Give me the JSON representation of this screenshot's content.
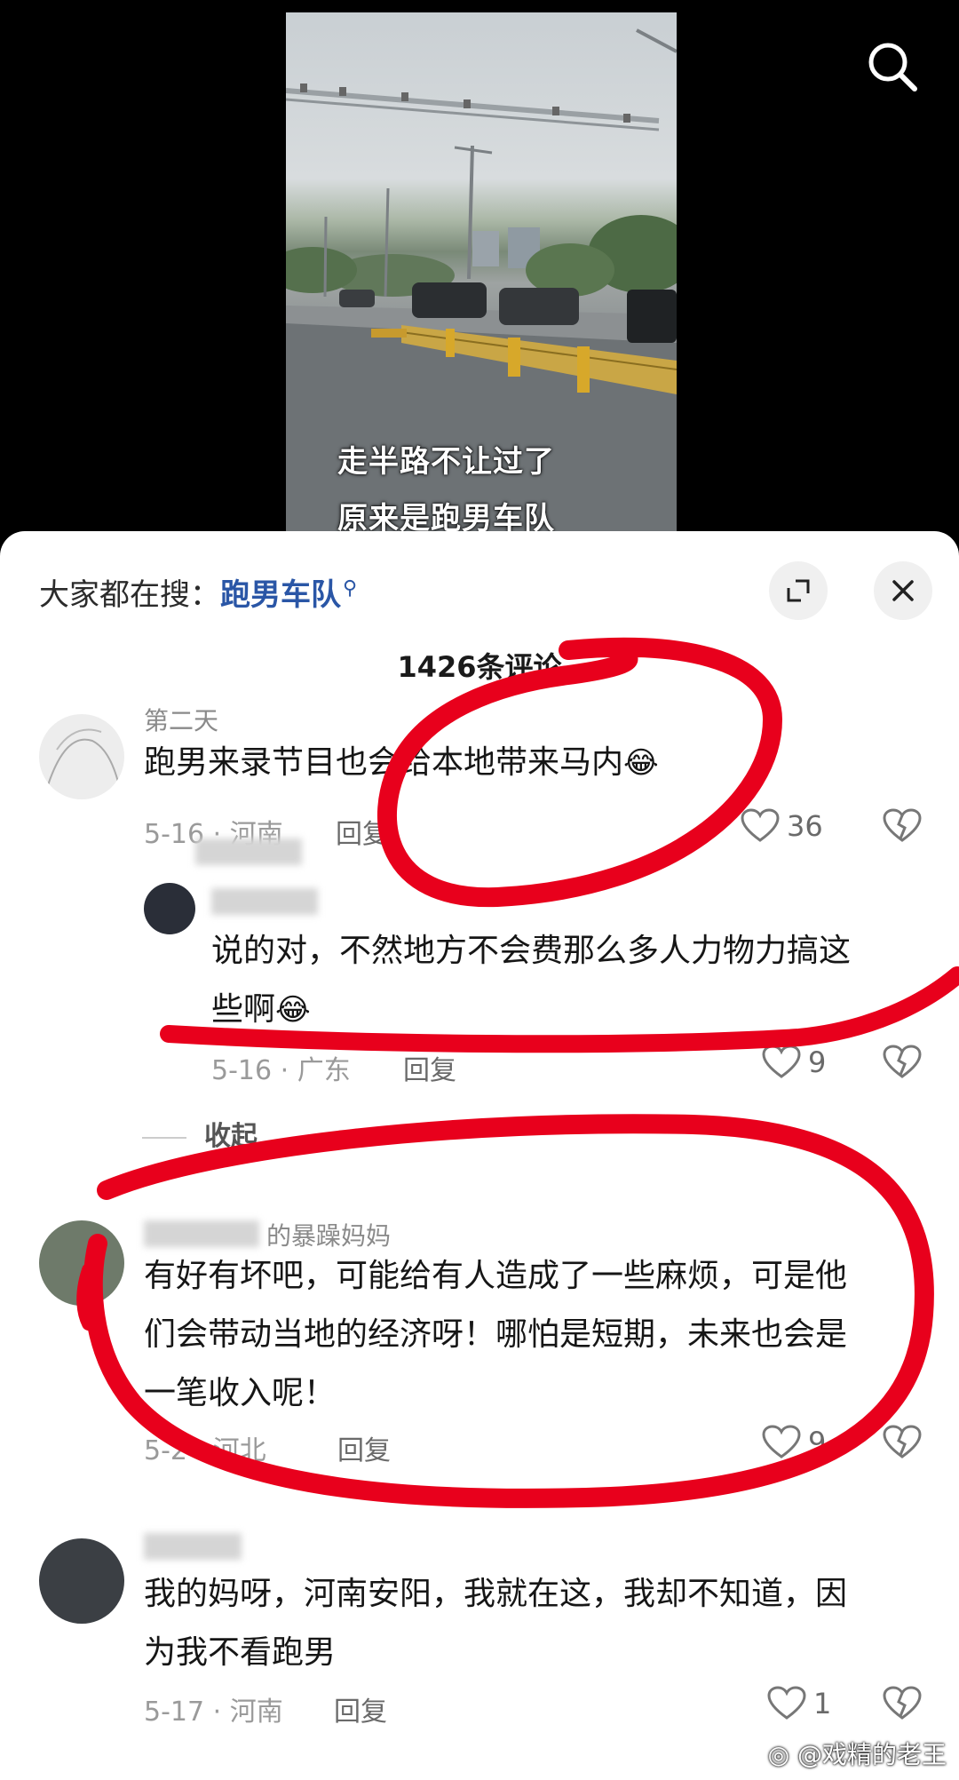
{
  "video": {
    "caption_line1": "走半路不让过了",
    "caption_line2": "原来是跑男车队",
    "search_icon": "search-icon"
  },
  "header": {
    "hot_search_prefix": "大家都在搜：",
    "hot_search_keyword": "跑男车队",
    "expand_icon": "expand-icon",
    "close_icon": "close-icon"
  },
  "comment_count": "1426条评论",
  "comments": [
    {
      "username": "第二天",
      "text": "跑男来录节目也会给本地带来马内",
      "emoji": "😂",
      "date_location": "5-16 · 河南",
      "reply_label": "回复",
      "likes": "36"
    },
    {
      "username": "",
      "text_line1": "说的对，不然地方不会费那么多人力物力搞这",
      "text_line2": "些啊",
      "emoji": "😂",
      "date_location": "5-16 · 广东",
      "reply_label": "回复",
      "likes": "9"
    },
    {
      "username": "的暴躁妈妈",
      "text_line1": "有好有坏吧，可能给有人造成了一些麻烦，可是他",
      "text_line2": "们会带动当地的经济呀！哪怕是短期，未来也会是",
      "text_line3": "一笔收入呢！",
      "date_location": "5-2 · 河北",
      "reply_label": "回复",
      "likes": "9"
    },
    {
      "username": "",
      "text_line1": "我的妈呀，河南安阳，我就在这，我却不知道，因",
      "text_line2": "为我不看跑男",
      "date_location": "5-17 · 河南",
      "reply_label": "回复",
      "likes": "1"
    }
  ],
  "collapse_label": "收起",
  "watermark": "@戏精的老王",
  "colors": {
    "annotation_red": "#e8001c",
    "keyword_blue": "#2a56a6"
  }
}
